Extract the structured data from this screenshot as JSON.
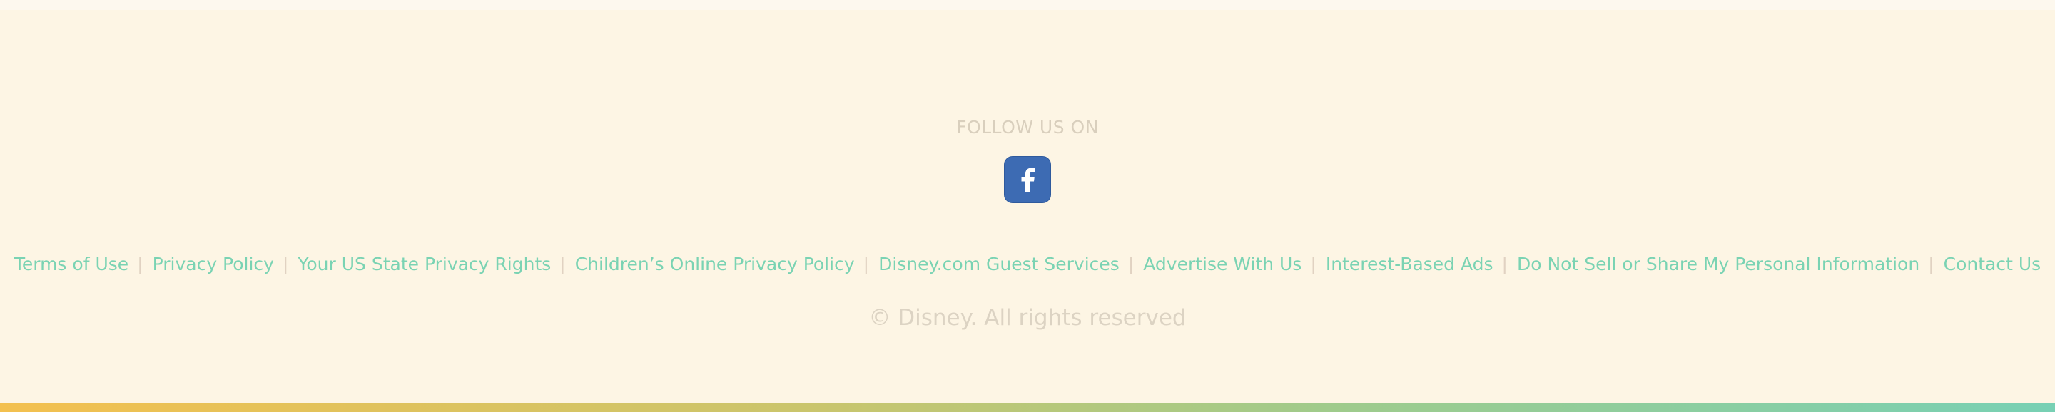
{
  "footer": {
    "follow_label": "FOLLOW US ON",
    "social": [
      {
        "icon": "facebook-icon",
        "color": "#3d6bb3"
      }
    ],
    "links": [
      "Terms of Use",
      "Privacy Policy",
      "Your US State Privacy Rights",
      "Children’s Online Privacy Policy",
      "Disney.com Guest Services",
      "Advertise With Us",
      "Interest-Based Ads",
      "Do Not Sell or Share My Personal Information",
      "Contact Us"
    ],
    "separator": "|",
    "copyright": "© Disney. All rights reserved"
  },
  "colors": {
    "background": "#fdf5e4",
    "link": "#7ad3b3",
    "muted_text": "#d9cfbd",
    "gradient_start": "#f3c04f",
    "gradient_end": "#78d0b4"
  }
}
